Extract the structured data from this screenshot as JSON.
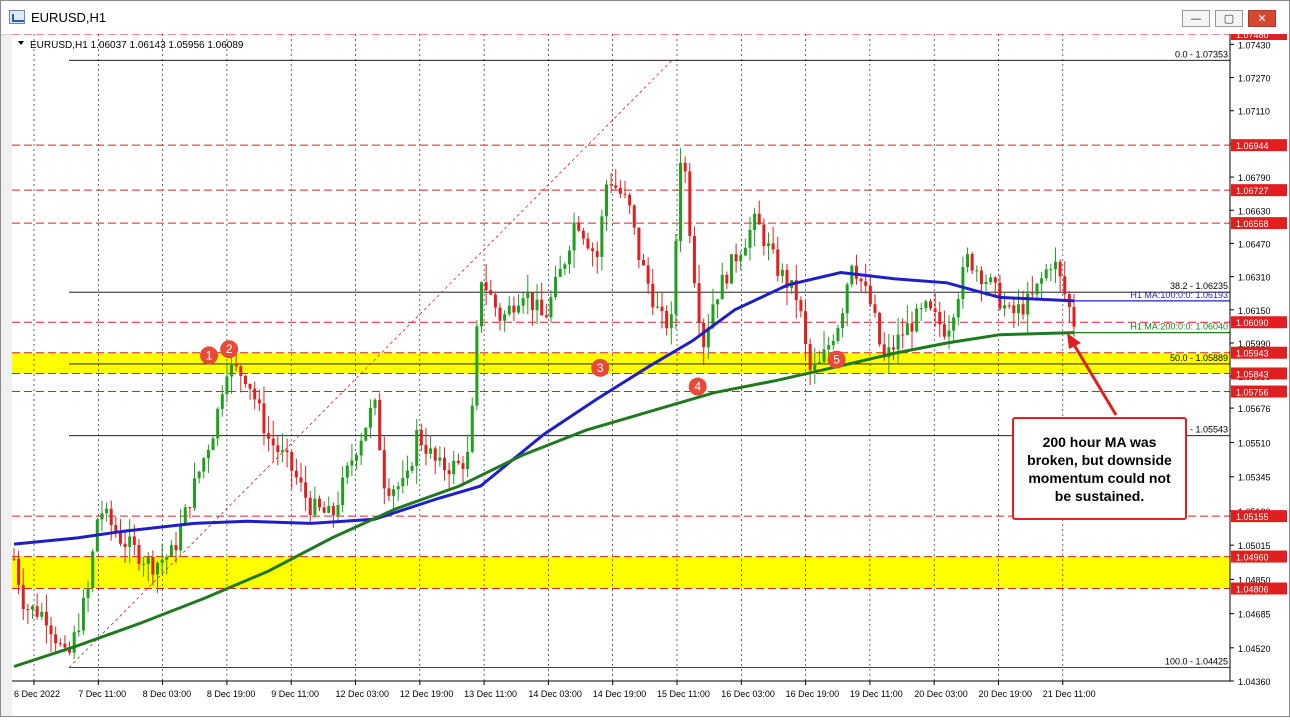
{
  "window": {
    "title": "EURUSD,H1",
    "buttons": {
      "minimize": "—",
      "maximize": "▢",
      "close": "✕"
    }
  },
  "chart_header": "EURUSD,H1  1.06037 1.06143 1.05956 1.06089",
  "chart_data": {
    "type": "line",
    "symbol": "EURUSD",
    "timeframe": "H1",
    "ohlc": {
      "open": 1.06037,
      "high": 1.06143,
      "low": 1.05956,
      "close": 1.06089
    },
    "ylim": [
      1.0436,
      1.0748
    ],
    "price_axis_ticks": [
      "1.07430",
      "1.07270",
      "1.07110",
      "1.06950",
      "1.06790",
      "1.06630",
      "1.06470",
      "1.06310",
      "1.06150",
      "1.05990",
      "1.05830",
      "1.05676",
      "1.05510",
      "1.05345",
      "1.05180",
      "1.05015",
      "1.04850",
      "1.04685",
      "1.04520",
      "1.04360"
    ],
    "x_tick_labels": [
      "6 Dec 2022",
      "7 Dec 11:00",
      "8 Dec 03:00",
      "8 Dec 19:00",
      "9 Dec 11:00",
      "12 Dec 03:00",
      "12 Dec 19:00",
      "13 Dec 11:00",
      "14 Dec 03:00",
      "14 Dec 19:00",
      "15 Dec 11:00",
      "16 Dec 03:00",
      "16 Dec 19:00",
      "19 Dec 11:00",
      "20 Dec 03:00",
      "20 Dec 19:00",
      "21 Dec 11:00"
    ],
    "horizontal_levels": [
      {
        "price": 1.0748,
        "label": "1.07480",
        "color": "#e02020"
      },
      {
        "price": 1.06944,
        "label": "1.06944",
        "color": "#e02020"
      },
      {
        "price": 1.06727,
        "label": "1.06727",
        "color": "#e02020"
      },
      {
        "price": 1.06568,
        "label": "1.06568",
        "color": "#e02020"
      },
      {
        "price": 1.0609,
        "label": "1.06090",
        "color": "#e02020"
      },
      {
        "price": 1.05943,
        "label": "1.05943",
        "color": "#e02020"
      },
      {
        "price": 1.05843,
        "label": "1.05843",
        "color": "#e02020"
      },
      {
        "price": 1.05756,
        "label": "1.05756",
        "color": "#e02020"
      },
      {
        "price": 1.05155,
        "label": "1.05155",
        "color": "#e02020"
      },
      {
        "price": 1.0496,
        "label": "1.04960",
        "color": "#e02020"
      },
      {
        "price": 1.04806,
        "label": "1.04806",
        "color": "#e02020"
      }
    ],
    "fib_levels": [
      {
        "price": 1.07353,
        "label": "0.0 - 1.07353"
      },
      {
        "price": 1.06235,
        "label": "38.2 - 1.06235"
      },
      {
        "price": 1.05889,
        "label": "50.0 - 1.05889"
      },
      {
        "price": 1.05543,
        "label": "B - 1.05543"
      },
      {
        "price": 1.04425,
        "label": "100.0 - 1.04425"
      }
    ],
    "yellow_zones": [
      [
        1.05843,
        1.05943
      ],
      [
        1.04806,
        1.0496
      ]
    ],
    "moving_averages": [
      {
        "name": "H1 MA:100:0:0:",
        "value_label": "1.06193",
        "value": 1.06193,
        "color": "#1f1fc8",
        "points": [
          [
            0,
            1.0502
          ],
          [
            0.06,
            1.0505
          ],
          [
            0.1,
            1.0508
          ],
          [
            0.17,
            1.0512
          ],
          [
            0.22,
            1.0513
          ],
          [
            0.28,
            1.0512
          ],
          [
            0.34,
            1.0514
          ],
          [
            0.4,
            1.0524
          ],
          [
            0.44,
            1.053
          ],
          [
            0.5,
            1.0555
          ],
          [
            0.55,
            1.0572
          ],
          [
            0.6,
            1.0588
          ],
          [
            0.64,
            1.06
          ],
          [
            0.68,
            1.0615
          ],
          [
            0.73,
            1.0627
          ],
          [
            0.78,
            1.0633
          ],
          [
            0.83,
            1.063
          ],
          [
            0.88,
            1.0628
          ],
          [
            0.93,
            1.0621
          ],
          [
            1.0,
            1.06193
          ]
        ]
      },
      {
        "name": "H1 MA:200:0:0:",
        "value_label": "1.06040",
        "value": 1.0604,
        "color": "#1e7a1e",
        "points": [
          [
            0,
            1.0443
          ],
          [
            0.06,
            1.0453
          ],
          [
            0.12,
            1.0464
          ],
          [
            0.18,
            1.0476
          ],
          [
            0.24,
            1.0489
          ],
          [
            0.3,
            1.0505
          ],
          [
            0.36,
            1.0519
          ],
          [
            0.42,
            1.053
          ],
          [
            0.48,
            1.0545
          ],
          [
            0.54,
            1.0557
          ],
          [
            0.6,
            1.0566
          ],
          [
            0.66,
            1.0575
          ],
          [
            0.72,
            1.0581
          ],
          [
            0.78,
            1.0588
          ],
          [
            0.83,
            1.0594
          ],
          [
            0.88,
            1.0599
          ],
          [
            0.93,
            1.0603
          ],
          [
            1.0,
            1.0604
          ]
        ]
      }
    ],
    "price_path": [
      [
        0,
        1.0495
      ],
      [
        0.01,
        1.0472
      ],
      [
        0.03,
        1.0468
      ],
      [
        0.05,
        1.0445
      ],
      [
        0.07,
        1.048
      ],
      [
        0.08,
        1.052
      ],
      [
        0.1,
        1.0505
      ],
      [
        0.13,
        1.0492
      ],
      [
        0.15,
        1.0498
      ],
      [
        0.17,
        1.053
      ],
      [
        0.19,
        1.056
      ],
      [
        0.2,
        1.0588
      ],
      [
        0.22,
        1.0583
      ],
      [
        0.24,
        1.0553
      ],
      [
        0.26,
        1.054
      ],
      [
        0.28,
        1.052
      ],
      [
        0.3,
        1.0515
      ],
      [
        0.32,
        1.0545
      ],
      [
        0.34,
        1.057
      ],
      [
        0.35,
        1.053
      ],
      [
        0.37,
        1.053
      ],
      [
        0.38,
        1.0555
      ],
      [
        0.39,
        1.0548
      ],
      [
        0.4,
        1.0539
      ],
      [
        0.42,
        1.054
      ],
      [
        0.43,
        1.0545
      ],
      [
        0.44,
        1.0632
      ],
      [
        0.46,
        1.061
      ],
      [
        0.48,
        1.0625
      ],
      [
        0.5,
        1.061
      ],
      [
        0.52,
        1.064
      ],
      [
        0.53,
        1.066
      ],
      [
        0.55,
        1.064
      ],
      [
        0.56,
        1.068
      ],
      [
        0.58,
        1.0665
      ],
      [
        0.59,
        1.064
      ],
      [
        0.61,
        1.061
      ],
      [
        0.62,
        1.0608
      ],
      [
        0.63,
        1.07
      ],
      [
        0.64,
        1.064
      ],
      [
        0.65,
        1.0598
      ],
      [
        0.66,
        1.062
      ],
      [
        0.68,
        1.064
      ],
      [
        0.7,
        1.0658
      ],
      [
        0.72,
        1.0635
      ],
      [
        0.74,
        1.062
      ],
      [
        0.75,
        1.0585
      ],
      [
        0.76,
        1.0588
      ],
      [
        0.78,
        1.0612
      ],
      [
        0.79,
        1.064
      ],
      [
        0.81,
        1.0615
      ],
      [
        0.82,
        1.059
      ],
      [
        0.84,
        1.0605
      ],
      [
        0.86,
        1.0615
      ],
      [
        0.88,
        1.0605
      ],
      [
        0.9,
        1.064
      ],
      [
        0.92,
        1.0628
      ],
      [
        0.94,
        1.0612
      ],
      [
        0.96,
        1.062
      ],
      [
        0.98,
        1.064
      ],
      [
        1.0,
        1.06089
      ]
    ]
  },
  "markers": [
    {
      "label": "1",
      "x": 0.184,
      "y": 1.0593
    },
    {
      "label": "2",
      "x": 0.203,
      "y": 1.0596
    },
    {
      "label": "3",
      "x": 0.553,
      "y": 1.0587
    },
    {
      "label": "4",
      "x": 0.645,
      "y": 1.0578
    },
    {
      "label": "5",
      "x": 0.776,
      "y": 1.0591
    }
  ],
  "annotation": {
    "text": "200 hour MA was broken, but downside momentum could not be sustained."
  },
  "colors": {
    "level": "#e02020",
    "zone": "#ffff00",
    "ma100": "#1f1fc8",
    "ma200": "#1e7a1e",
    "bull": "#1ea01e",
    "bear": "#e02020",
    "marker": "#e84a3a"
  }
}
